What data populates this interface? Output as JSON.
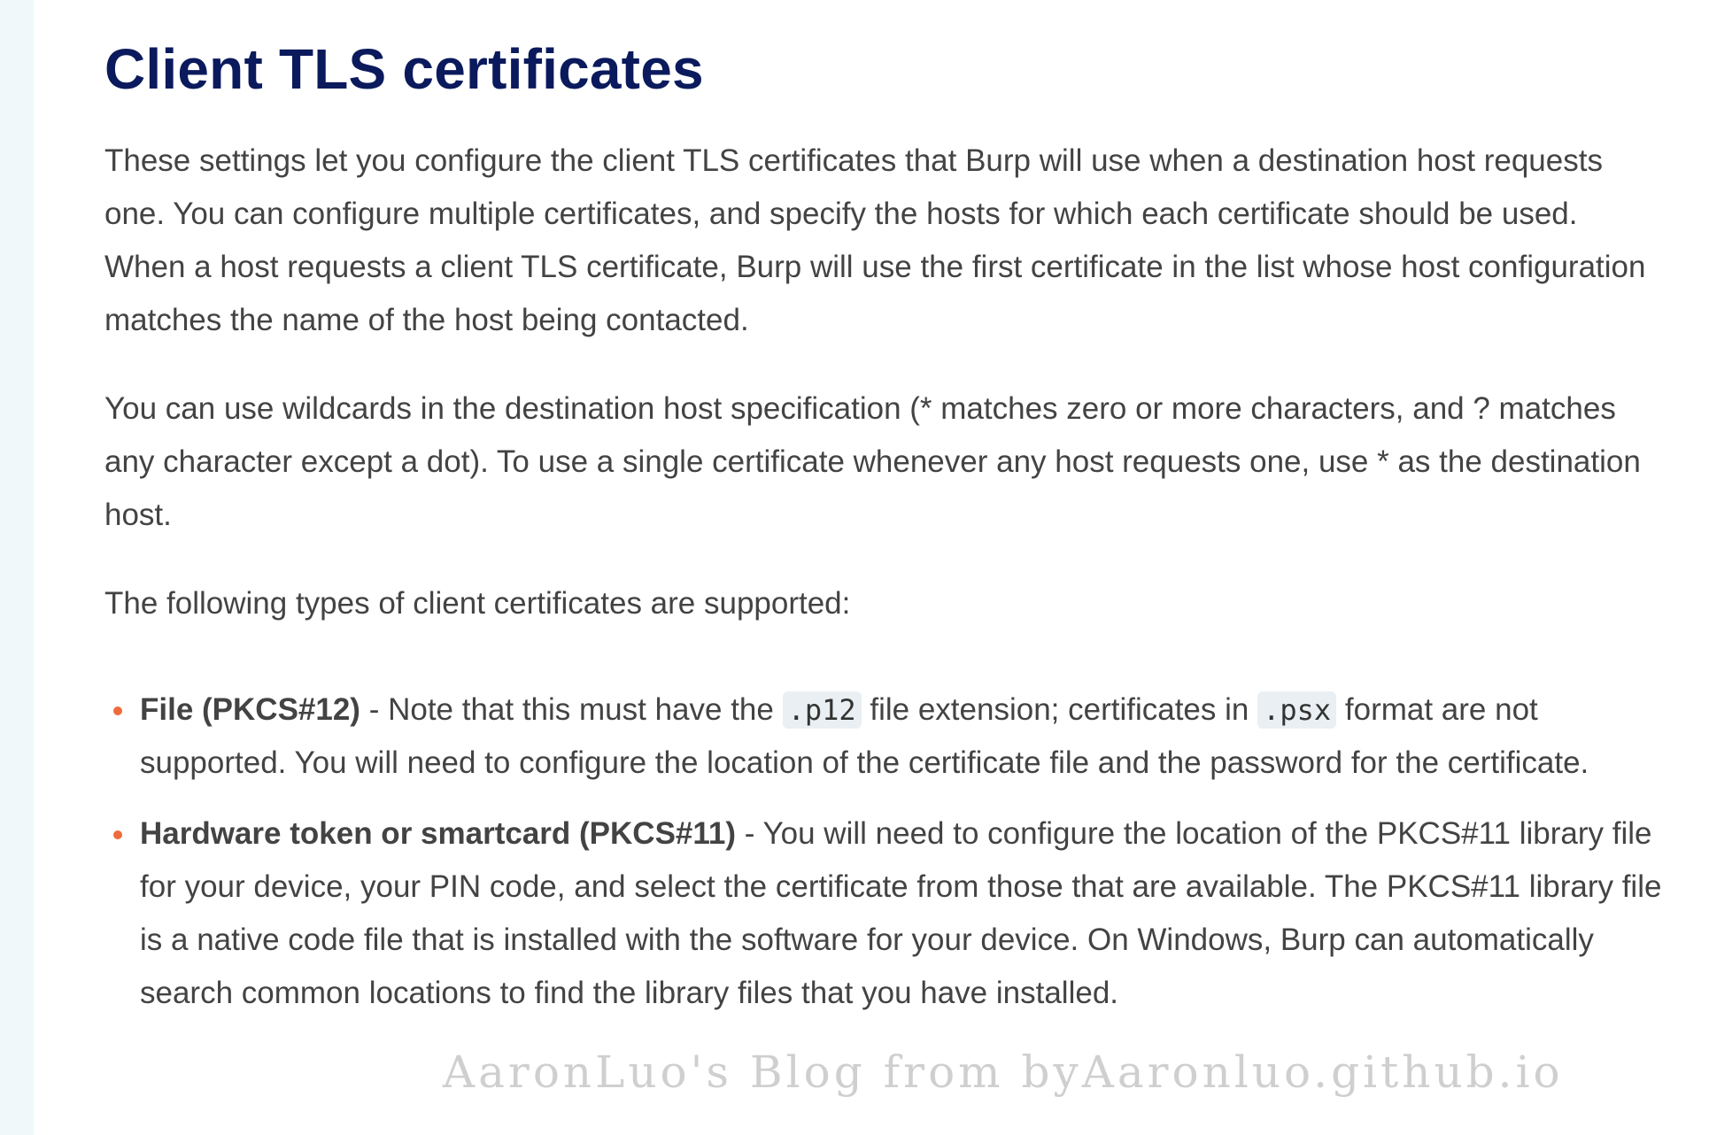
{
  "title": "Client TLS certificates",
  "paragraphs": [
    "These settings let you configure the client TLS certificates that Burp will use when a destination host requests one. You can configure multiple certificates, and specify the hosts for which each certificate should be used. When a host requests a client TLS certificate, Burp will use the first certificate in the list whose host configuration matches the name of the host being contacted.",
    "You can use wildcards in the destination host specification (* matches zero or more characters, and ? matches any character except a dot). To use a single certificate whenever any host requests one, use * as the destination host.",
    "The following types of client certificates are supported:"
  ],
  "list": [
    {
      "term": "File (PKCS#12)",
      "text_a": " - Note that this must have the ",
      "code_a": ".p12",
      "text_b": " file extension; certificates in ",
      "code_b": ".psx",
      "text_c": " format are not supported. You will need to configure the location of the certificate file and the password for the certificate."
    },
    {
      "term": "Hardware token or smartcard (PKCS#11)",
      "text_a": " - You will need to configure the location of the PKCS#11 library file for your device, your PIN code, and select the certificate from those that are available. The PKCS#11 library file is a native code file that is installed with the software for your device. On Windows, Burp can automatically search common locations to find the library files that you have installed."
    }
  ],
  "watermark": "AaronLuo's Blog from byAaronluo.github.io",
  "colors": {
    "title": "#0b1a5c",
    "body_text": "#434343",
    "bullet": "#ee6b3b",
    "code_bg": "#e9eff2",
    "page_bg": "#f0f8fa"
  }
}
